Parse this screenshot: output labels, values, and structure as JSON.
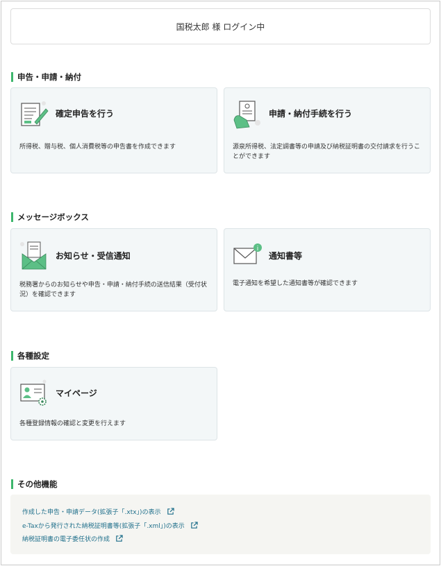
{
  "header": {
    "login_status": "国税太郎 様 ログイン中"
  },
  "sections": {
    "filing": {
      "title": "申告・申請・納付",
      "cards": [
        {
          "title": "確定申告を行う",
          "icon": "form-pen-icon",
          "desc": "所得税、贈与税、個人消費税等の申告書を作成できます"
        },
        {
          "title": "申請・納付手続を行う",
          "icon": "document-hand-icon",
          "desc": "源泉所得税、法定調書等の申請及び納税証明書の交付請求を行うことができます"
        }
      ]
    },
    "messages": {
      "title": "メッセージボックス",
      "cards": [
        {
          "title": "お知らせ・受信通知",
          "icon": "envelope-open-icon",
          "desc": "税務署からのお知らせや申告・申請・納付手続の送信結果（受付状況）を確認できます"
        },
        {
          "title": "通知書等",
          "icon": "envelope-info-icon",
          "desc": "電子通知を希望した通知書等が確認できます"
        }
      ]
    },
    "settings": {
      "title": "各種設定",
      "cards": [
        {
          "title": "マイページ",
          "icon": "profile-gear-icon",
          "desc": "各種登録情報の確認と変更を行えます"
        }
      ]
    },
    "other": {
      "title": "その他機能",
      "links": [
        {
          "label": "作成した申告・申請データ(拡張子「.xtx」)の表示",
          "icon": "external-link-icon"
        },
        {
          "label": "e-Taxから発行された納税証明書等(拡張子「.xml」)の表示",
          "icon": "external-link-icon"
        },
        {
          "label": "納税証明書の電子委任状の作成",
          "icon": "external-link-icon"
        }
      ]
    }
  },
  "colors": {
    "accent": "#3db66c",
    "card_bg": "#f3f7f8",
    "link": "#1f6f8b",
    "icon_green": "#5cbf86"
  }
}
